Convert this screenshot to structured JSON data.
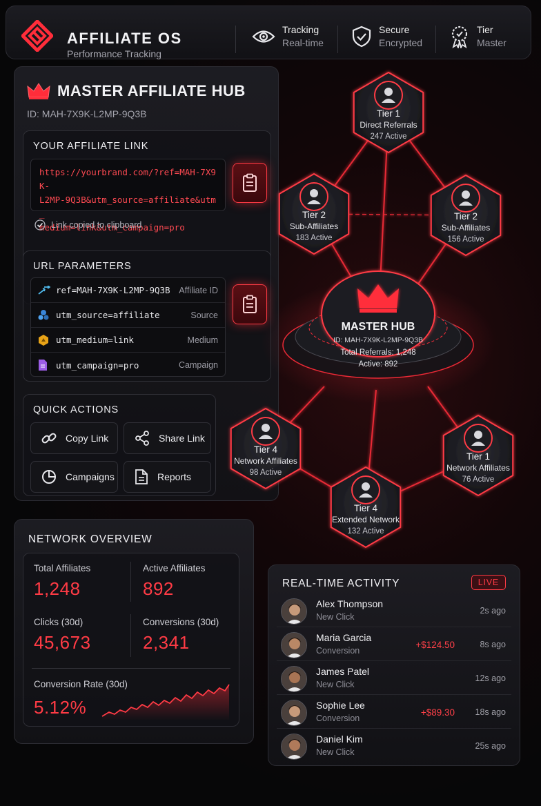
{
  "header": {
    "brand_title": "AFFILIATE OS",
    "brand_subtitle": "Performance Tracking",
    "items": [
      {
        "title": "Tracking",
        "subtitle": "Real-time",
        "icon": "eye-icon"
      },
      {
        "title": "Secure",
        "subtitle": "Encrypted",
        "icon": "shield-check-icon"
      },
      {
        "title": "Tier",
        "subtitle": "Master",
        "icon": "badge-icon"
      }
    ]
  },
  "hub": {
    "title": "MASTER AFFILIATE HUB",
    "id": "ID: MAH-7X9K-L2MP-9Q3B",
    "link_section_label": "YOUR AFFILIATE LINK",
    "link_lines": [
      "https://yourbrand.com/?ref=MAH-7X9K-",
      "L2MP-9Q3B&utm_source=affiliate&utm_",
      "medium=link&utm_campaign=pro"
    ],
    "copied_text": "Link copied to clipboard",
    "params_label": "URL PARAMETERS",
    "params": [
      {
        "value": "ref=MAH-7X9K-L2MP-9Q3B",
        "label": "Affiliate ID",
        "icon": "link-arrow-icon"
      },
      {
        "value": "utm_source=affiliate",
        "label": "Source",
        "icon": "source-icon"
      },
      {
        "value": "utm_medium=link",
        "label": "Medium",
        "icon": "medium-icon"
      },
      {
        "value": "utm_campaign=pro",
        "label": "Campaign",
        "icon": "document-icon"
      }
    ],
    "quick_actions_label": "QUICK ACTIONS",
    "quick_actions": [
      {
        "label": "Copy Link",
        "icon": "chain-link-icon"
      },
      {
        "label": "Share Link",
        "icon": "share-icon"
      },
      {
        "label": "Campaigns",
        "icon": "pie-chart-icon"
      },
      {
        "label": "Reports",
        "icon": "report-icon"
      }
    ]
  },
  "network_graph": {
    "center": {
      "title": "MASTER HUB",
      "id": "ID: MAH-7X9K-L2MP-9Q3B",
      "referrals": "Total Referrals: 1,248",
      "active": "Active: 892"
    },
    "nodes": [
      {
        "tier": "Tier 1",
        "name": "Direct Referrals",
        "active": "247 Active"
      },
      {
        "tier": "Tier 2",
        "name": "Sub-Affiliates",
        "active": "183 Active"
      },
      {
        "tier": "Tier 2",
        "name": "Sub-Affiliates",
        "active": "156 Active"
      },
      {
        "tier": "Tier 4",
        "name": "Network Affiliates",
        "active": "98 Active"
      },
      {
        "tier": "Tier 1",
        "name": "Network Affiliates",
        "active": "76 Active"
      },
      {
        "tier": "Tier 4",
        "name": "Extended Network",
        "active": "132 Active"
      }
    ]
  },
  "network_overview": {
    "title": "NETWORK OVERVIEW",
    "total_affiliates_label": "Total Affiliates",
    "total_affiliates": "1,248",
    "active_affiliates_label": "Active Affiliates",
    "active_affiliates": "892",
    "clicks_label": "Clicks (30d)",
    "clicks": "45,673",
    "conversions_label": "Conversions (30d)",
    "conversions": "2,341",
    "conversion_rate_label": "Conversion Rate (30d)",
    "conversion_rate": "5.12%"
  },
  "activity": {
    "title": "REAL-TIME ACTIVITY",
    "live_label": "LIVE",
    "items": [
      {
        "name": "Alex Thompson",
        "type": "New Click",
        "amount": "",
        "time": "2s ago"
      },
      {
        "name": "Maria Garcia",
        "type": "Conversion",
        "amount": "+$124.50",
        "time": "8s ago"
      },
      {
        "name": "James Patel",
        "type": "New Click",
        "amount": "",
        "time": "12s ago"
      },
      {
        "name": "Sophie Lee",
        "type": "Conversion",
        "amount": "+$89.30",
        "time": "18s ago"
      },
      {
        "name": "Daniel Kim",
        "type": "New Click",
        "amount": "",
        "time": "25s ago"
      }
    ]
  },
  "colors": {
    "accent": "#ff3b45",
    "background": "#0a0a0c",
    "panel": "#1a1a1f"
  }
}
